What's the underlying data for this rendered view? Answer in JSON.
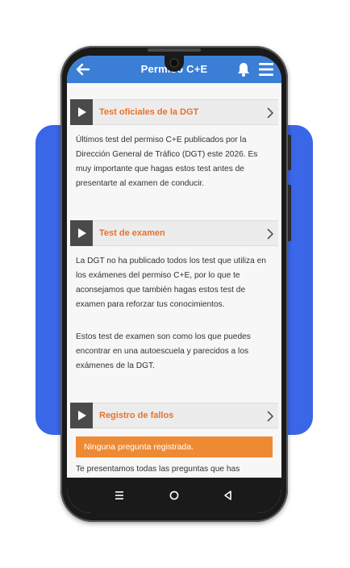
{
  "appbar": {
    "title": "Permiso C+E"
  },
  "sections": [
    {
      "label": "Test oficiales de la DGT",
      "paragraphs": [
        "Últimos test del permiso C+E publicados por la Dirección General de Tráfico (DGT) este 2026. Es muy importante que hagas estos test antes de presentarte al examen de conducir."
      ]
    },
    {
      "label": "Test de examen",
      "paragraphs": [
        "La DGT no ha publicado todos los test que utiliza en los exámenes del permiso C+E, por lo que te aconsejamos que también hagas estos test de examen para reforzar tus conocimientos.",
        "Estos test de examen son como los que puedes encontrar en una autoescuela y parecidos a los exámenes de la DGT."
      ]
    },
    {
      "label": "Registro de fallos",
      "alert": "Ninguna pregunta registrada.",
      "paragraphs": [
        "Te presentamos todas las preguntas que has"
      ]
    }
  ],
  "colors": {
    "accent_blue": "#3a7fd5",
    "backdrop_blue": "#3a66e8",
    "orange": "#e8722a",
    "alert_orange": "#ef8a34"
  },
  "icons": {
    "back": "arrow-left-icon",
    "bell": "bell-icon",
    "menu": "hamburger-menu-icon",
    "section": "play-icon",
    "chevron": "chevron-right-icon",
    "nav": [
      "recent-apps-icon",
      "home-circle-icon",
      "back-triangle-icon"
    ]
  }
}
